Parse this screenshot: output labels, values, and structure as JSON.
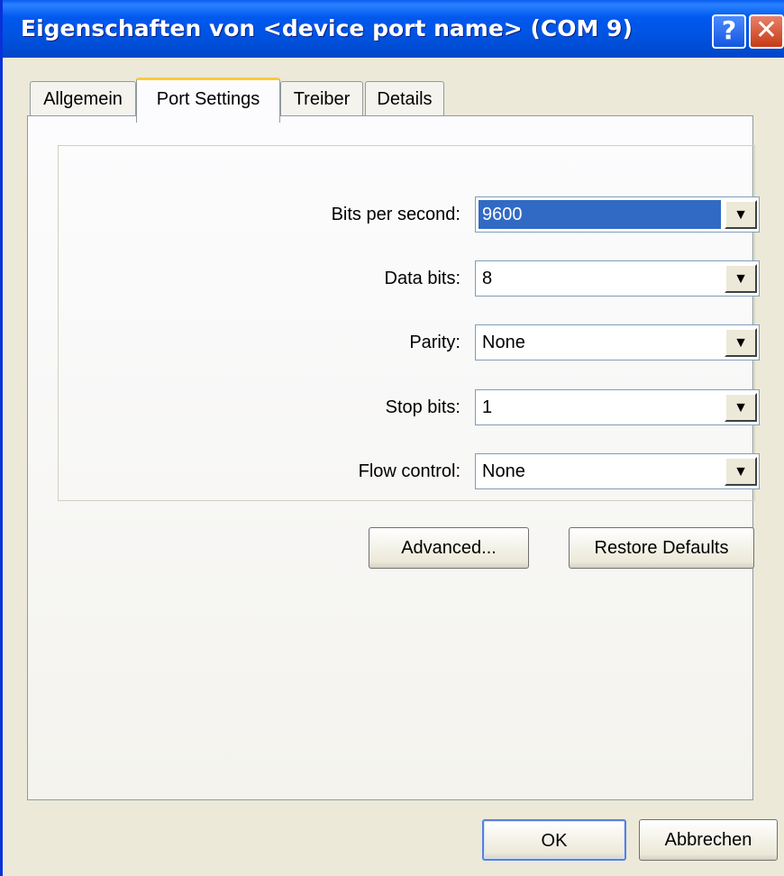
{
  "window": {
    "title": "Eigenschaften von <device port name> (COM 9)",
    "help_label": "?",
    "close_label": "✕"
  },
  "tabs": [
    {
      "label": "Allgemein",
      "active": false
    },
    {
      "label": "Port Settings",
      "active": true
    },
    {
      "label": "Treiber",
      "active": false
    },
    {
      "label": "Details",
      "active": false
    }
  ],
  "port_settings": {
    "rows": [
      {
        "label": "Bits per second:",
        "value": "9600",
        "selected": true
      },
      {
        "label": "Data bits:",
        "value": "8",
        "selected": false
      },
      {
        "label": "Parity:",
        "value": "None",
        "selected": false
      },
      {
        "label": "Stop bits:",
        "value": "1",
        "selected": false
      },
      {
        "label": "Flow control:",
        "value": "None",
        "selected": false
      }
    ],
    "advanced_label": "Advanced...",
    "restore_label": "Restore Defaults"
  },
  "footer": {
    "ok_label": "OK",
    "cancel_label": "Abbrechen"
  },
  "icons": {
    "dropdown": "▼"
  },
  "colors": {
    "titlebar": "#0054e3",
    "selection": "#316ac5",
    "tab_highlight": "#ffc83c",
    "close_button": "#c63b14"
  }
}
